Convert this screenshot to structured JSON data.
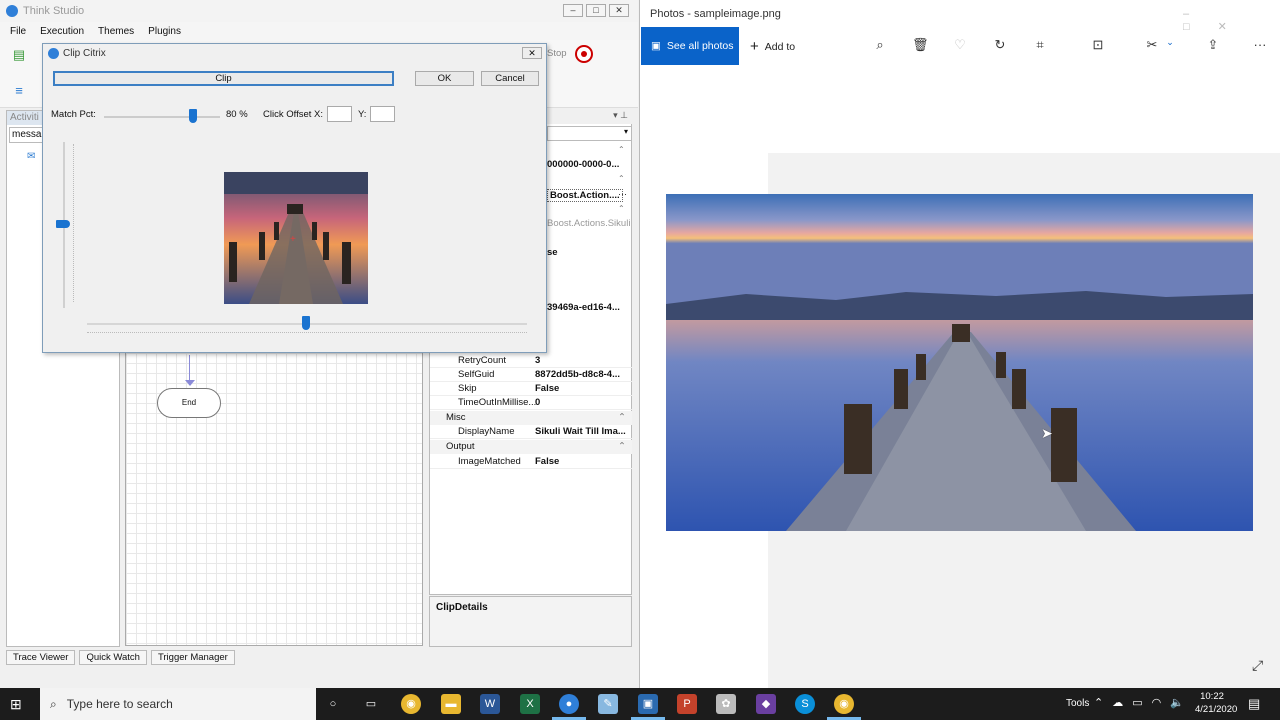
{
  "left_app": {
    "title": "Think Studio",
    "menu": [
      "File",
      "Execution",
      "Themes",
      "Plugins"
    ],
    "window_buttons": [
      "–",
      "□",
      "✕"
    ],
    "toolbar_stop_label": "Stop",
    "activities_header": "Activiti",
    "activities_search": "messa",
    "end_node_label": "End",
    "properties": {
      "top_values": [
        "000000-0000-0...",
        "Boost.Action....",
        "Boost.Actions.Sikuli",
        "se",
        "39469a-ed16-4..."
      ],
      "rows": [
        {
          "name": "RetryCount",
          "value": "3"
        },
        {
          "name": "SelfGuid",
          "value": "8872dd5b-d8c8-4..."
        },
        {
          "name": "Skip",
          "value": "False"
        },
        {
          "name": "TimeOutInMillise...",
          "value": "0"
        }
      ],
      "category_misc": "Misc",
      "misc_rows": [
        {
          "name": "DisplayName",
          "value": "Sikuli Wait Till Ima..."
        }
      ],
      "category_output": "Output",
      "output_rows": [
        {
          "name": "ImageMatched",
          "value": "False"
        }
      ]
    },
    "clip_details": "ClipDetails",
    "bottom_tabs": [
      "Trace Viewer",
      "Quick Watch",
      "Trigger Manager"
    ]
  },
  "dialog": {
    "title": "Clip Citrix",
    "clip_label": "Clip",
    "ok_label": "OK",
    "cancel_label": "Cancel",
    "match_pct_label": "Match Pct:",
    "match_pct_value": "80 %",
    "match_pct_fraction": 0.8,
    "click_offset_label": "Click Offset",
    "x_label": "X:",
    "y_label": "Y:",
    "x_value": "",
    "y_value": ""
  },
  "photos": {
    "window_title": "Photos - sampleimage.png",
    "see_all_label": "See all photos",
    "add_to_label": "Add to",
    "toolbar_icons": [
      "zoom-icon",
      "delete-icon",
      "heart-icon",
      "rotate-icon",
      "crop-icon",
      "enhance-icon",
      "edit-icon",
      "share-icon",
      "more-icon"
    ]
  },
  "taskbar": {
    "search_placeholder": "Type here to search",
    "tools_label": "Tools",
    "time": "10:22",
    "date": "4/21/2020"
  },
  "colors": {
    "accent": "#0a63c9",
    "slider": "#1a73d0",
    "taskbar": "#1c1c1c"
  }
}
